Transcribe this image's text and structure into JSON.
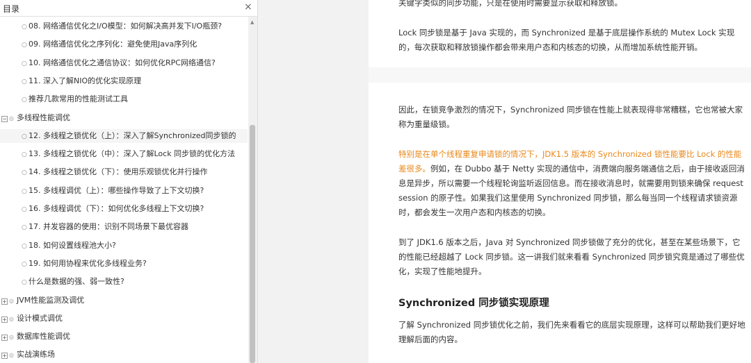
{
  "toc": {
    "title": "目录",
    "close_icon": "×",
    "items": [
      {
        "type": "child",
        "label": "08. 网络通信优化之I/O模型：如何解决高并发下I/O瓶颈?"
      },
      {
        "type": "child",
        "label": "09. 网络通信优化之序列化：避免使用Java序列化"
      },
      {
        "type": "child",
        "label": "10. 网络通信优化之通信协议：如何优化RPC网络通信?"
      },
      {
        "type": "child",
        "label": "11. 深入了解NIO的优化实现原理"
      },
      {
        "type": "child",
        "label": "推荐几款常用的性能测试工具"
      },
      {
        "type": "group",
        "expander": "−",
        "label": "多线程性能调优"
      },
      {
        "type": "child",
        "label": "12. 多线程之锁优化（上）：深入了解Synchronized同步锁的",
        "selected": true
      },
      {
        "type": "child",
        "label": "13. 多线程之锁优化（中）：深入了解Lock 同步锁的优化方法"
      },
      {
        "type": "child",
        "label": "14. 多线程之锁优化（下）：使用乐观锁优化并行操作"
      },
      {
        "type": "child",
        "label": "15. 多线程调优（上）：哪些操作导致了上下文切换?"
      },
      {
        "type": "child",
        "label": "16. 多线程调优（下）：如何优化多线程上下文切换?"
      },
      {
        "type": "child",
        "label": "17. 并发容器的使用：识别不同场景下最优容器"
      },
      {
        "type": "child",
        "label": "18. 如何设置线程池大小?"
      },
      {
        "type": "child",
        "label": "19. 如何用协程来优化多线程业务?"
      },
      {
        "type": "child",
        "label": "什么是数据的强、弱一致性?"
      },
      {
        "type": "group",
        "expander": "+",
        "label": "JVM性能监测及调优"
      },
      {
        "type": "group",
        "expander": "+",
        "label": "设计模式调优"
      },
      {
        "type": "group",
        "expander": "+",
        "label": "数据库性能调优"
      },
      {
        "type": "group",
        "expander": "+",
        "label": "实战演练场"
      }
    ]
  },
  "article": {
    "p0": "关键字类似的同步功能，只是在使用时需要显示获取和释放锁。",
    "p1": "Lock 同步锁是基于 Java 实现的，而 Synchronized 是基于底层操作系统的 Mutex Lock 实现的，每次获取和释放锁操作都会带来用户态和内核态的切换，从而增加系统性能开销。",
    "p2": "因此，在锁竞争激烈的情况下，Synchronized 同步锁在性能上就表现得非常糟糕，它也常被大家称为重量级锁。",
    "p3_highlight": "特别是在单个线程重复申请锁的情况下，JDK1.5 版本的 Synchronized 锁性能要比 Lock 的性能差很多。",
    "p3_rest": "例如，在 Dubbo 基于 Netty 实现的通信中，消费端向服务端通信之后，由于接收返回消息是异步，所以需要一个线程轮询监听返回信息。而在接收消息时，就需要用到锁来确保 request session 的原子性。如果我们这里使用 Synchronized 同步锁，那么每当同一个线程请求锁资源时，都会发生一次用户态和内核态的切换。",
    "p4": "到了 JDK1.6 版本之后，Java 对 Synchronized 同步锁做了充分的优化，甚至在某些场景下，它的性能已经超越了 Lock 同步锁。这一讲我们就来看看 Synchronized 同步锁究竟是通过了哪些优化，实现了性能地提升。",
    "heading": "Synchronized 同步锁实现原理",
    "p5": "了解 Synchronized 同步锁优化之前，我们先来看看它的底层实现原理，这样可以帮助我们更好地理解后面的内容。"
  },
  "colors": {
    "highlight": "#e8891c",
    "scroll_thumb": "#c1c1c1"
  }
}
